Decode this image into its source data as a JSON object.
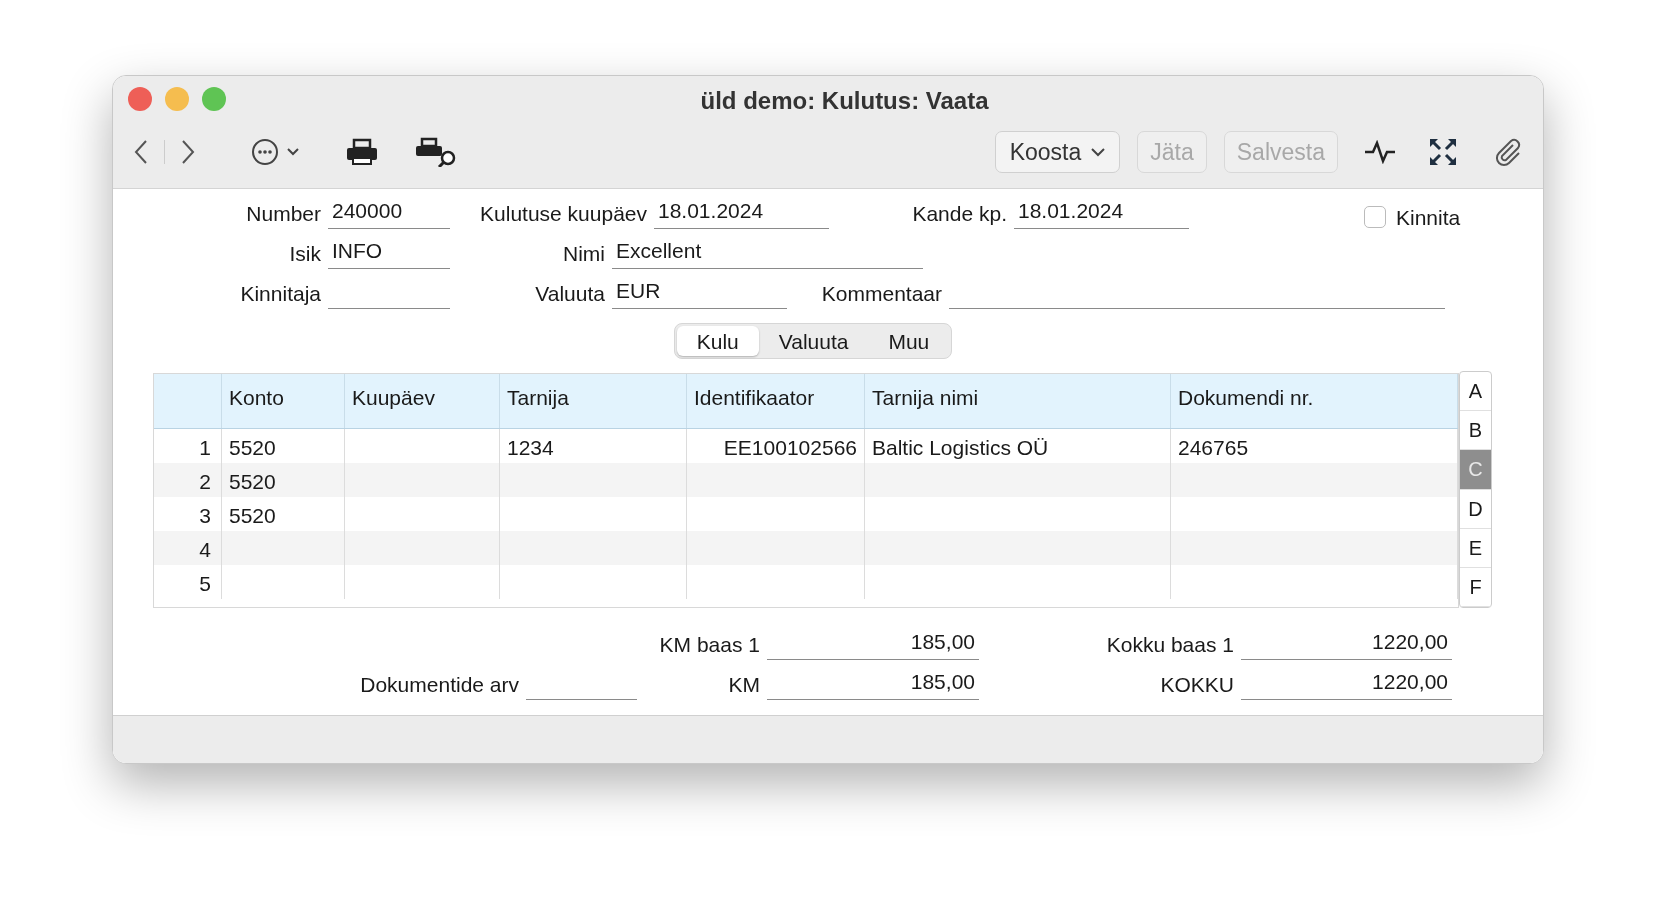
{
  "window": {
    "title": "üld demo: Kulutus: Vaata"
  },
  "toolbar": {
    "compose": "Koosta",
    "buttons": [
      {
        "label": "Jäta",
        "disabled": true
      },
      {
        "label": "Salvesta",
        "disabled": true
      }
    ]
  },
  "header": {
    "number": {
      "label": "Number",
      "value": "240000"
    },
    "expense_date": {
      "label": "Kulutuse kuupäev",
      "value": "18.01.2024"
    },
    "entry_date": {
      "label": "Kande kp.",
      "value": "18.01.2024"
    },
    "approve": {
      "label": "Kinnita",
      "checked": false
    },
    "person": {
      "label": "Isik",
      "value": "INFO"
    },
    "name": {
      "label": "Nimi",
      "value": "Excellent"
    },
    "approver": {
      "label": "Kinnitaja"
    },
    "currency": {
      "label": "Valuuta",
      "value": "EUR"
    },
    "comment": {
      "label": "Kommentaar"
    }
  },
  "tabs": [
    {
      "label": "Kulu",
      "selected": true
    },
    {
      "label": "Valuuta",
      "selected": false
    },
    {
      "label": "Muu",
      "selected": false
    }
  ],
  "table": {
    "columns": [
      "Konto",
      "Kuupäev",
      "Tarnija",
      "Identifikaator",
      "Tarnija nimi",
      "Dokumendi nr."
    ],
    "rows": [
      {
        "num": "1",
        "cells": [
          "5520",
          "",
          "1234",
          "EE100102566",
          "Baltic Logistics OÜ",
          "246765"
        ]
      },
      {
        "num": "2",
        "cells": [
          "5520",
          "",
          "",
          "",
          "",
          ""
        ]
      },
      {
        "num": "3",
        "cells": [
          "5520",
          "",
          "",
          "",
          "",
          ""
        ]
      },
      {
        "num": "4",
        "cells": [
          "",
          "",
          "",
          "",
          "",
          ""
        ]
      },
      {
        "num": "5",
        "cells": [
          "",
          "",
          "",
          "",
          "",
          ""
        ]
      }
    ]
  },
  "side_tabs": [
    {
      "label": "A",
      "selected": false
    },
    {
      "label": "B",
      "selected": false
    },
    {
      "label": "C",
      "selected": true
    },
    {
      "label": "D",
      "selected": false
    },
    {
      "label": "E",
      "selected": false
    },
    {
      "label": "F",
      "selected": false
    }
  ],
  "totals": {
    "doc_count": {
      "label": "Dokumentide arv"
    },
    "vat_base": {
      "label": "KM baas 1",
      "value": "185,00"
    },
    "vat": {
      "label": "KM",
      "value": "185,00"
    },
    "total_base": {
      "label": "Kokku baas 1",
      "value": "1220,00"
    },
    "total": {
      "label": "KOKKU",
      "value": "1220,00"
    }
  }
}
